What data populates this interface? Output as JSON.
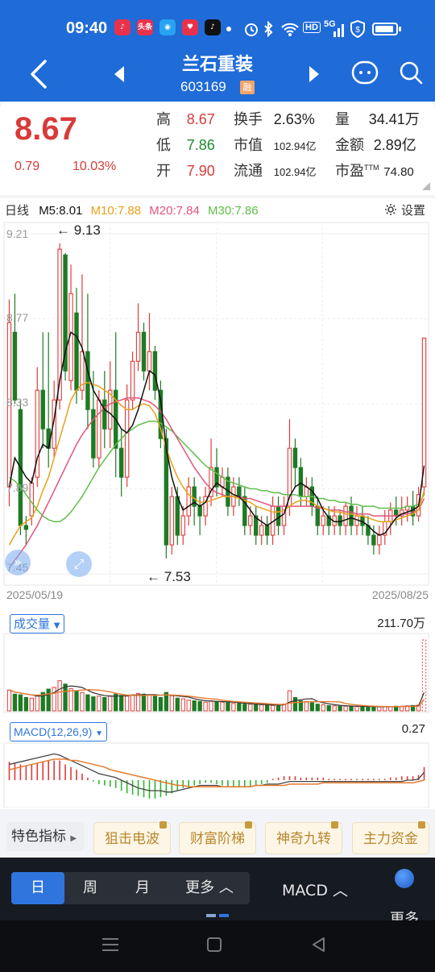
{
  "status": {
    "time": "09:40",
    "apps": [
      {
        "name": "music-app-icon",
        "glyph": "♪",
        "bg": "#e8324b"
      },
      {
        "name": "toutiao-app-icon",
        "glyph": "头条",
        "bg": "#e8324b"
      },
      {
        "name": "blue-app-icon",
        "glyph": "◉",
        "bg": "#27a3f0"
      },
      {
        "name": "heart-app-icon",
        "glyph": "♥",
        "bg": "#e8324b"
      },
      {
        "name": "tiktok-app-icon",
        "glyph": "♪",
        "bg": "#111111"
      }
    ],
    "hd": "HD",
    "net": "5G"
  },
  "nav": {
    "title": "兰石重装",
    "code": "603169",
    "badge": "融"
  },
  "quote": {
    "price": "8.67",
    "change": "0.79",
    "change_pct": "10.03%",
    "high_label": "高",
    "high": "8.67",
    "low_label": "低",
    "low": "7.86",
    "open_label": "开",
    "open": "7.90",
    "turnover_label": "换手",
    "turnover": "2.63%",
    "mktcap_label": "市值",
    "mktcap": "102.94亿",
    "float_label": "流通",
    "float": "102.94亿",
    "volume_label": "量",
    "volume": "34.41万",
    "amount_label": "金额",
    "amount": "2.89亿",
    "pe_label": "市盈",
    "pe_sup": "TTM",
    "pe": "74.80"
  },
  "ma": {
    "period": "日线",
    "m5": "M5:8.01",
    "m10": "M10:7.88",
    "m20": "M20:7.84",
    "m30": "M30:7.86",
    "settings": "设置"
  },
  "colors": {
    "up": "#e03b3b",
    "down": "#1e7a24",
    "m5": "#111111",
    "m10": "#e8a21a",
    "m20": "#e2557c",
    "m30": "#5fbf4a"
  },
  "chart_data": [
    {
      "type": "candlestick",
      "yaxis_labels": [
        "9.21",
        "8.77",
        "8.33",
        "7.89",
        "7.45"
      ],
      "ylim": [
        7.45,
        9.21
      ],
      "x_start": "2025/05/19",
      "x_end": "2025/08/25",
      "max_annotation": "9.13",
      "min_annotation": "7.53",
      "candles": [
        [
          7.9,
          8.75,
          7.8,
          8.87
        ],
        [
          8.7,
          8.35,
          8.33,
          8.9
        ],
        [
          8.3,
          7.7,
          7.65,
          8.35
        ],
        [
          7.7,
          7.68,
          7.6,
          7.75
        ],
        [
          7.75,
          7.92,
          7.7,
          7.95
        ],
        [
          7.95,
          8.4,
          7.9,
          8.52
        ],
        [
          8.4,
          8.2,
          8.1,
          8.7
        ],
        [
          8.2,
          8.1,
          8.0,
          8.7
        ],
        [
          8.1,
          8.35,
          8.05,
          8.45
        ],
        [
          8.35,
          9.13,
          8.3,
          9.16
        ],
        [
          9.1,
          8.5,
          8.45,
          9.11
        ],
        [
          8.45,
          8.9,
          8.4,
          9.05
        ],
        [
          8.8,
          8.4,
          8.33,
          8.93
        ],
        [
          8.4,
          8.6,
          8.35,
          9.0
        ],
        [
          8.6,
          8.3,
          8.2,
          8.9
        ],
        [
          8.3,
          8.05,
          8.0,
          8.5
        ],
        [
          8.05,
          8.35,
          8.0,
          8.4
        ],
        [
          8.35,
          8.2,
          8.1,
          8.5
        ],
        [
          8.2,
          8.4,
          8.1,
          8.55
        ],
        [
          8.4,
          8.1,
          7.95,
          8.7
        ],
        [
          8.1,
          7.95,
          7.85,
          8.2
        ],
        [
          7.95,
          8.35,
          7.9,
          8.43
        ],
        [
          8.35,
          8.55,
          8.3,
          8.6
        ],
        [
          8.55,
          8.7,
          8.5,
          8.85
        ],
        [
          8.7,
          8.5,
          8.45,
          8.75
        ],
        [
          8.5,
          8.6,
          8.4,
          8.8
        ],
        [
          8.6,
          8.4,
          8.35,
          8.63
        ],
        [
          8.4,
          8.15,
          8.1,
          8.45
        ],
        [
          8.15,
          7.6,
          7.53,
          8.2
        ],
        [
          7.6,
          7.85,
          7.55,
          7.9
        ],
        [
          7.85,
          7.65,
          7.6,
          7.9
        ],
        [
          7.65,
          7.75,
          7.6,
          7.8
        ],
        [
          7.75,
          7.9,
          7.7,
          7.95
        ],
        [
          7.9,
          7.8,
          7.7,
          7.95
        ],
        [
          7.8,
          7.75,
          7.65,
          7.85
        ],
        [
          7.75,
          7.85,
          7.7,
          7.9
        ],
        [
          7.85,
          8.0,
          7.8,
          8.15
        ],
        [
          8.0,
          7.9,
          7.85,
          8.1
        ],
        [
          7.9,
          7.95,
          7.85,
          8.0
        ],
        [
          7.95,
          7.8,
          7.75,
          8.0
        ],
        [
          7.8,
          7.9,
          7.75,
          7.95
        ],
        [
          7.9,
          7.85,
          7.8,
          7.95
        ],
        [
          7.85,
          7.7,
          7.65,
          7.9
        ],
        [
          7.7,
          7.75,
          7.65,
          7.8
        ],
        [
          7.75,
          7.65,
          7.6,
          7.8
        ],
        [
          7.65,
          7.7,
          7.6,
          7.75
        ],
        [
          7.7,
          7.65,
          7.6,
          7.75
        ],
        [
          7.65,
          7.8,
          7.6,
          7.85
        ],
        [
          7.8,
          7.7,
          7.65,
          7.85
        ],
        [
          7.7,
          7.8,
          7.65,
          7.85
        ],
        [
          7.8,
          8.1,
          7.75,
          8.25
        ],
        [
          8.1,
          8.0,
          7.9,
          8.15
        ],
        [
          8.0,
          7.85,
          7.8,
          8.05
        ],
        [
          7.85,
          7.9,
          7.8,
          7.95
        ],
        [
          7.9,
          7.8,
          7.75,
          7.95
        ],
        [
          7.8,
          7.7,
          7.65,
          7.85
        ],
        [
          7.7,
          7.75,
          7.65,
          7.8
        ],
        [
          7.75,
          7.7,
          7.65,
          7.8
        ],
        [
          7.7,
          7.75,
          7.65,
          7.8
        ],
        [
          7.75,
          7.7,
          7.65,
          7.78
        ],
        [
          7.7,
          7.8,
          7.65,
          7.82
        ],
        [
          7.8,
          7.7,
          7.65,
          7.85
        ],
        [
          7.7,
          7.75,
          7.65,
          7.8
        ],
        [
          7.75,
          7.7,
          7.65,
          7.8
        ],
        [
          7.7,
          7.65,
          7.6,
          7.75
        ],
        [
          7.65,
          7.6,
          7.55,
          7.7
        ],
        [
          7.6,
          7.65,
          7.55,
          7.7
        ],
        [
          7.65,
          7.72,
          7.6,
          7.78
        ],
        [
          7.72,
          7.78,
          7.65,
          7.82
        ],
        [
          7.78,
          7.75,
          7.7,
          7.85
        ],
        [
          7.75,
          7.78,
          7.7,
          7.85
        ],
        [
          7.78,
          7.8,
          7.72,
          7.85
        ],
        [
          7.8,
          7.75,
          7.7,
          7.88
        ],
        [
          7.75,
          7.86,
          7.72,
          7.9
        ],
        [
          7.9,
          8.67,
          7.86,
          8.67
        ]
      ],
      "ma": {
        "m5": [
          7.9,
          8.05,
          8.0,
          7.95,
          7.92,
          8.05,
          8.12,
          8.1,
          8.25,
          8.45,
          8.6,
          8.7,
          8.68,
          8.62,
          8.5,
          8.4,
          8.35,
          8.3,
          8.28,
          8.25,
          8.2,
          8.18,
          8.22,
          8.3,
          8.4,
          8.5,
          8.48,
          8.35,
          8.1,
          7.95,
          7.85,
          7.78,
          7.8,
          7.82,
          7.8,
          7.82,
          7.88,
          7.92,
          7.9,
          7.88,
          7.86,
          7.85,
          7.82,
          7.78,
          7.74,
          7.72,
          7.7,
          7.72,
          7.74,
          7.76,
          7.85,
          7.9,
          7.92,
          7.9,
          7.88,
          7.84,
          7.78,
          7.74,
          7.72,
          7.72,
          7.73,
          7.74,
          7.73,
          7.72,
          7.7,
          7.67,
          7.65,
          7.66,
          7.7,
          7.74,
          7.76,
          7.77,
          7.78,
          7.8,
          8.01
        ],
        "m10": [
          7.6,
          7.65,
          7.7,
          7.72,
          7.74,
          7.8,
          7.88,
          7.95,
          8.05,
          8.15,
          8.25,
          8.35,
          8.4,
          8.43,
          8.44,
          8.43,
          8.42,
          8.4,
          8.38,
          8.35,
          8.32,
          8.3,
          8.3,
          8.32,
          8.33,
          8.32,
          8.28,
          8.2,
          8.1,
          8.02,
          7.95,
          7.9,
          7.86,
          7.84,
          7.82,
          7.82,
          7.83,
          7.84,
          7.85,
          7.85,
          7.85,
          7.84,
          7.83,
          7.82,
          7.8,
          7.79,
          7.78,
          7.77,
          7.77,
          7.78,
          7.8,
          7.82,
          7.83,
          7.83,
          7.82,
          7.8,
          7.79,
          7.78,
          7.77,
          7.77,
          7.76,
          7.76,
          7.75,
          7.75,
          7.74,
          7.73,
          7.72,
          7.72,
          7.72,
          7.73,
          7.74,
          7.75,
          7.76,
          7.78,
          7.88
        ],
        "m20": [
          7.48,
          7.52,
          7.56,
          7.6,
          7.65,
          7.7,
          7.76,
          7.82,
          7.88,
          7.94,
          8.0,
          8.06,
          8.12,
          8.17,
          8.21,
          8.25,
          8.28,
          8.31,
          8.33,
          8.34,
          8.35,
          8.36,
          8.36,
          8.36,
          8.35,
          8.34,
          8.32,
          8.29,
          8.25,
          8.2,
          8.15,
          8.1,
          8.05,
          8.0,
          7.96,
          7.92,
          7.89,
          7.87,
          7.86,
          7.85,
          7.85,
          7.85,
          7.84,
          7.84,
          7.83,
          7.82,
          7.81,
          7.8,
          7.8,
          7.8,
          7.8,
          7.8,
          7.8,
          7.8,
          7.8,
          7.79,
          7.79,
          7.78,
          7.78,
          7.78,
          7.77,
          7.77,
          7.76,
          7.76,
          7.76,
          7.75,
          7.75,
          7.75,
          7.75,
          7.75,
          7.76,
          7.76,
          7.77,
          7.78,
          7.84
        ],
        "m30": [
          7.95,
          7.93,
          7.9,
          7.86,
          7.82,
          7.78,
          7.75,
          7.73,
          7.72,
          7.72,
          7.74,
          7.77,
          7.81,
          7.85,
          7.9,
          7.95,
          8.0,
          8.04,
          8.08,
          8.12,
          8.15,
          8.18,
          8.2,
          8.22,
          8.23,
          8.24,
          8.24,
          8.23,
          8.21,
          8.19,
          8.16,
          8.13,
          8.1,
          8.07,
          8.04,
          8.01,
          7.99,
          7.97,
          7.95,
          7.93,
          7.92,
          7.91,
          7.9,
          7.89,
          7.89,
          7.88,
          7.88,
          7.87,
          7.87,
          7.86,
          7.86,
          7.86,
          7.85,
          7.85,
          7.85,
          7.84,
          7.84,
          7.83,
          7.83,
          7.82,
          7.82,
          7.81,
          7.81,
          7.8,
          7.8,
          7.8,
          7.79,
          7.79,
          7.79,
          7.79,
          7.79,
          7.8,
          7.8,
          7.81,
          7.86
        ]
      }
    },
    {
      "type": "bar",
      "title": "成交量",
      "max_label": "211.70万",
      "ylim": [
        0,
        211.7
      ],
      "values": [
        62,
        50,
        48,
        40,
        38,
        45,
        55,
        65,
        70,
        90,
        80,
        66,
        58,
        55,
        48,
        42,
        44,
        40,
        45,
        50,
        46,
        44,
        48,
        52,
        50,
        48,
        44,
        40,
        55,
        45,
        38,
        36,
        32,
        30,
        28,
        26,
        30,
        28,
        26,
        24,
        22,
        22,
        20,
        20,
        18,
        18,
        17,
        16,
        18,
        20,
        60,
        40,
        30,
        28,
        24,
        20,
        18,
        16,
        15,
        14,
        14,
        14,
        13,
        13,
        12,
        12,
        12,
        12,
        13,
        14,
        14,
        15,
        16,
        17,
        211.7
      ]
    },
    {
      "type": "bar",
      "title": "MACD(12,26,9)",
      "max_label": "0.27",
      "ylim": [
        -0.27,
        0.27
      ],
      "values": [
        0.14,
        0.13,
        0.12,
        0.11,
        0.12,
        0.13,
        0.14,
        0.15,
        0.15,
        0.15,
        0.12,
        0.1,
        0.08,
        0.05,
        0.02,
        -0.01,
        -0.03,
        -0.04,
        -0.05,
        -0.06,
        -0.08,
        -0.1,
        -0.11,
        -0.12,
        -0.13,
        -0.14,
        -0.14,
        -0.13,
        -0.12,
        -0.1,
        -0.08,
        -0.06,
        -0.05,
        -0.04,
        -0.03,
        -0.02,
        -0.02,
        -0.03,
        -0.04,
        -0.05,
        -0.05,
        -0.05,
        -0.05,
        -0.05,
        -0.04,
        -0.03,
        -0.02,
        0.01,
        0.02,
        0.03,
        0.03,
        0.03,
        0.02,
        0.02,
        0.02,
        0.02,
        0.02,
        0.01,
        0.01,
        0.01,
        0.01,
        0.01,
        0.01,
        0.01,
        0.01,
        0.01,
        0.01,
        0.01,
        0.02,
        0.02,
        0.03,
        0.03,
        0.03,
        0.04,
        0.1
      ],
      "dif": [
        0.12,
        0.13,
        0.14,
        0.15,
        0.16,
        0.17,
        0.18,
        0.19,
        0.2,
        0.19,
        0.17,
        0.15,
        0.13,
        0.11,
        0.09,
        0.07,
        0.05,
        0.04,
        0.03,
        0.02,
        0.0,
        -0.02,
        -0.04,
        -0.06,
        -0.07,
        -0.08,
        -0.08,
        -0.08,
        -0.09,
        -0.09,
        -0.08,
        -0.07,
        -0.06,
        -0.05,
        -0.04,
        -0.04,
        -0.04,
        -0.04,
        -0.05,
        -0.05,
        -0.05,
        -0.05,
        -0.05,
        -0.05,
        -0.04,
        -0.04,
        -0.03,
        -0.03,
        -0.03,
        -0.02,
        -0.01,
        -0.01,
        -0.01,
        -0.01,
        -0.01,
        -0.01,
        -0.01,
        -0.01,
        -0.01,
        -0.01,
        -0.01,
        -0.01,
        -0.01,
        -0.01,
        -0.01,
        -0.01,
        -0.01,
        -0.01,
        -0.01,
        -0.01,
        -0.01,
        0.0,
        0.0,
        0.01,
        0.06
      ],
      "dea": [
        0.08,
        0.09,
        0.1,
        0.11,
        0.12,
        0.13,
        0.14,
        0.15,
        0.16,
        0.16,
        0.16,
        0.15,
        0.15,
        0.14,
        0.13,
        0.12,
        0.11,
        0.1,
        0.08,
        0.07,
        0.06,
        0.05,
        0.04,
        0.03,
        0.02,
        0.01,
        0.0,
        -0.01,
        -0.02,
        -0.03,
        -0.04,
        -0.04,
        -0.05,
        -0.05,
        -0.05,
        -0.05,
        -0.05,
        -0.05,
        -0.05,
        -0.05,
        -0.05,
        -0.05,
        -0.05,
        -0.05,
        -0.04,
        -0.04,
        -0.04,
        -0.04,
        -0.04,
        -0.04,
        -0.03,
        -0.03,
        -0.03,
        -0.03,
        -0.03,
        -0.03,
        -0.02,
        -0.02,
        -0.02,
        -0.02,
        -0.02,
        -0.02,
        -0.02,
        -0.02,
        -0.02,
        -0.02,
        -0.02,
        -0.02,
        -0.02,
        -0.02,
        -0.02,
        -0.02,
        -0.02,
        -0.01,
        0.0
      ]
    }
  ],
  "tags": {
    "label": "特色指标",
    "items": [
      "狙击电波",
      "财富阶梯",
      "神奇九转",
      "主力资金"
    ]
  },
  "tabs": {
    "day": "日",
    "week": "周",
    "month": "月",
    "more": "更多",
    "macd": "MACD",
    "more_right": "更多"
  }
}
